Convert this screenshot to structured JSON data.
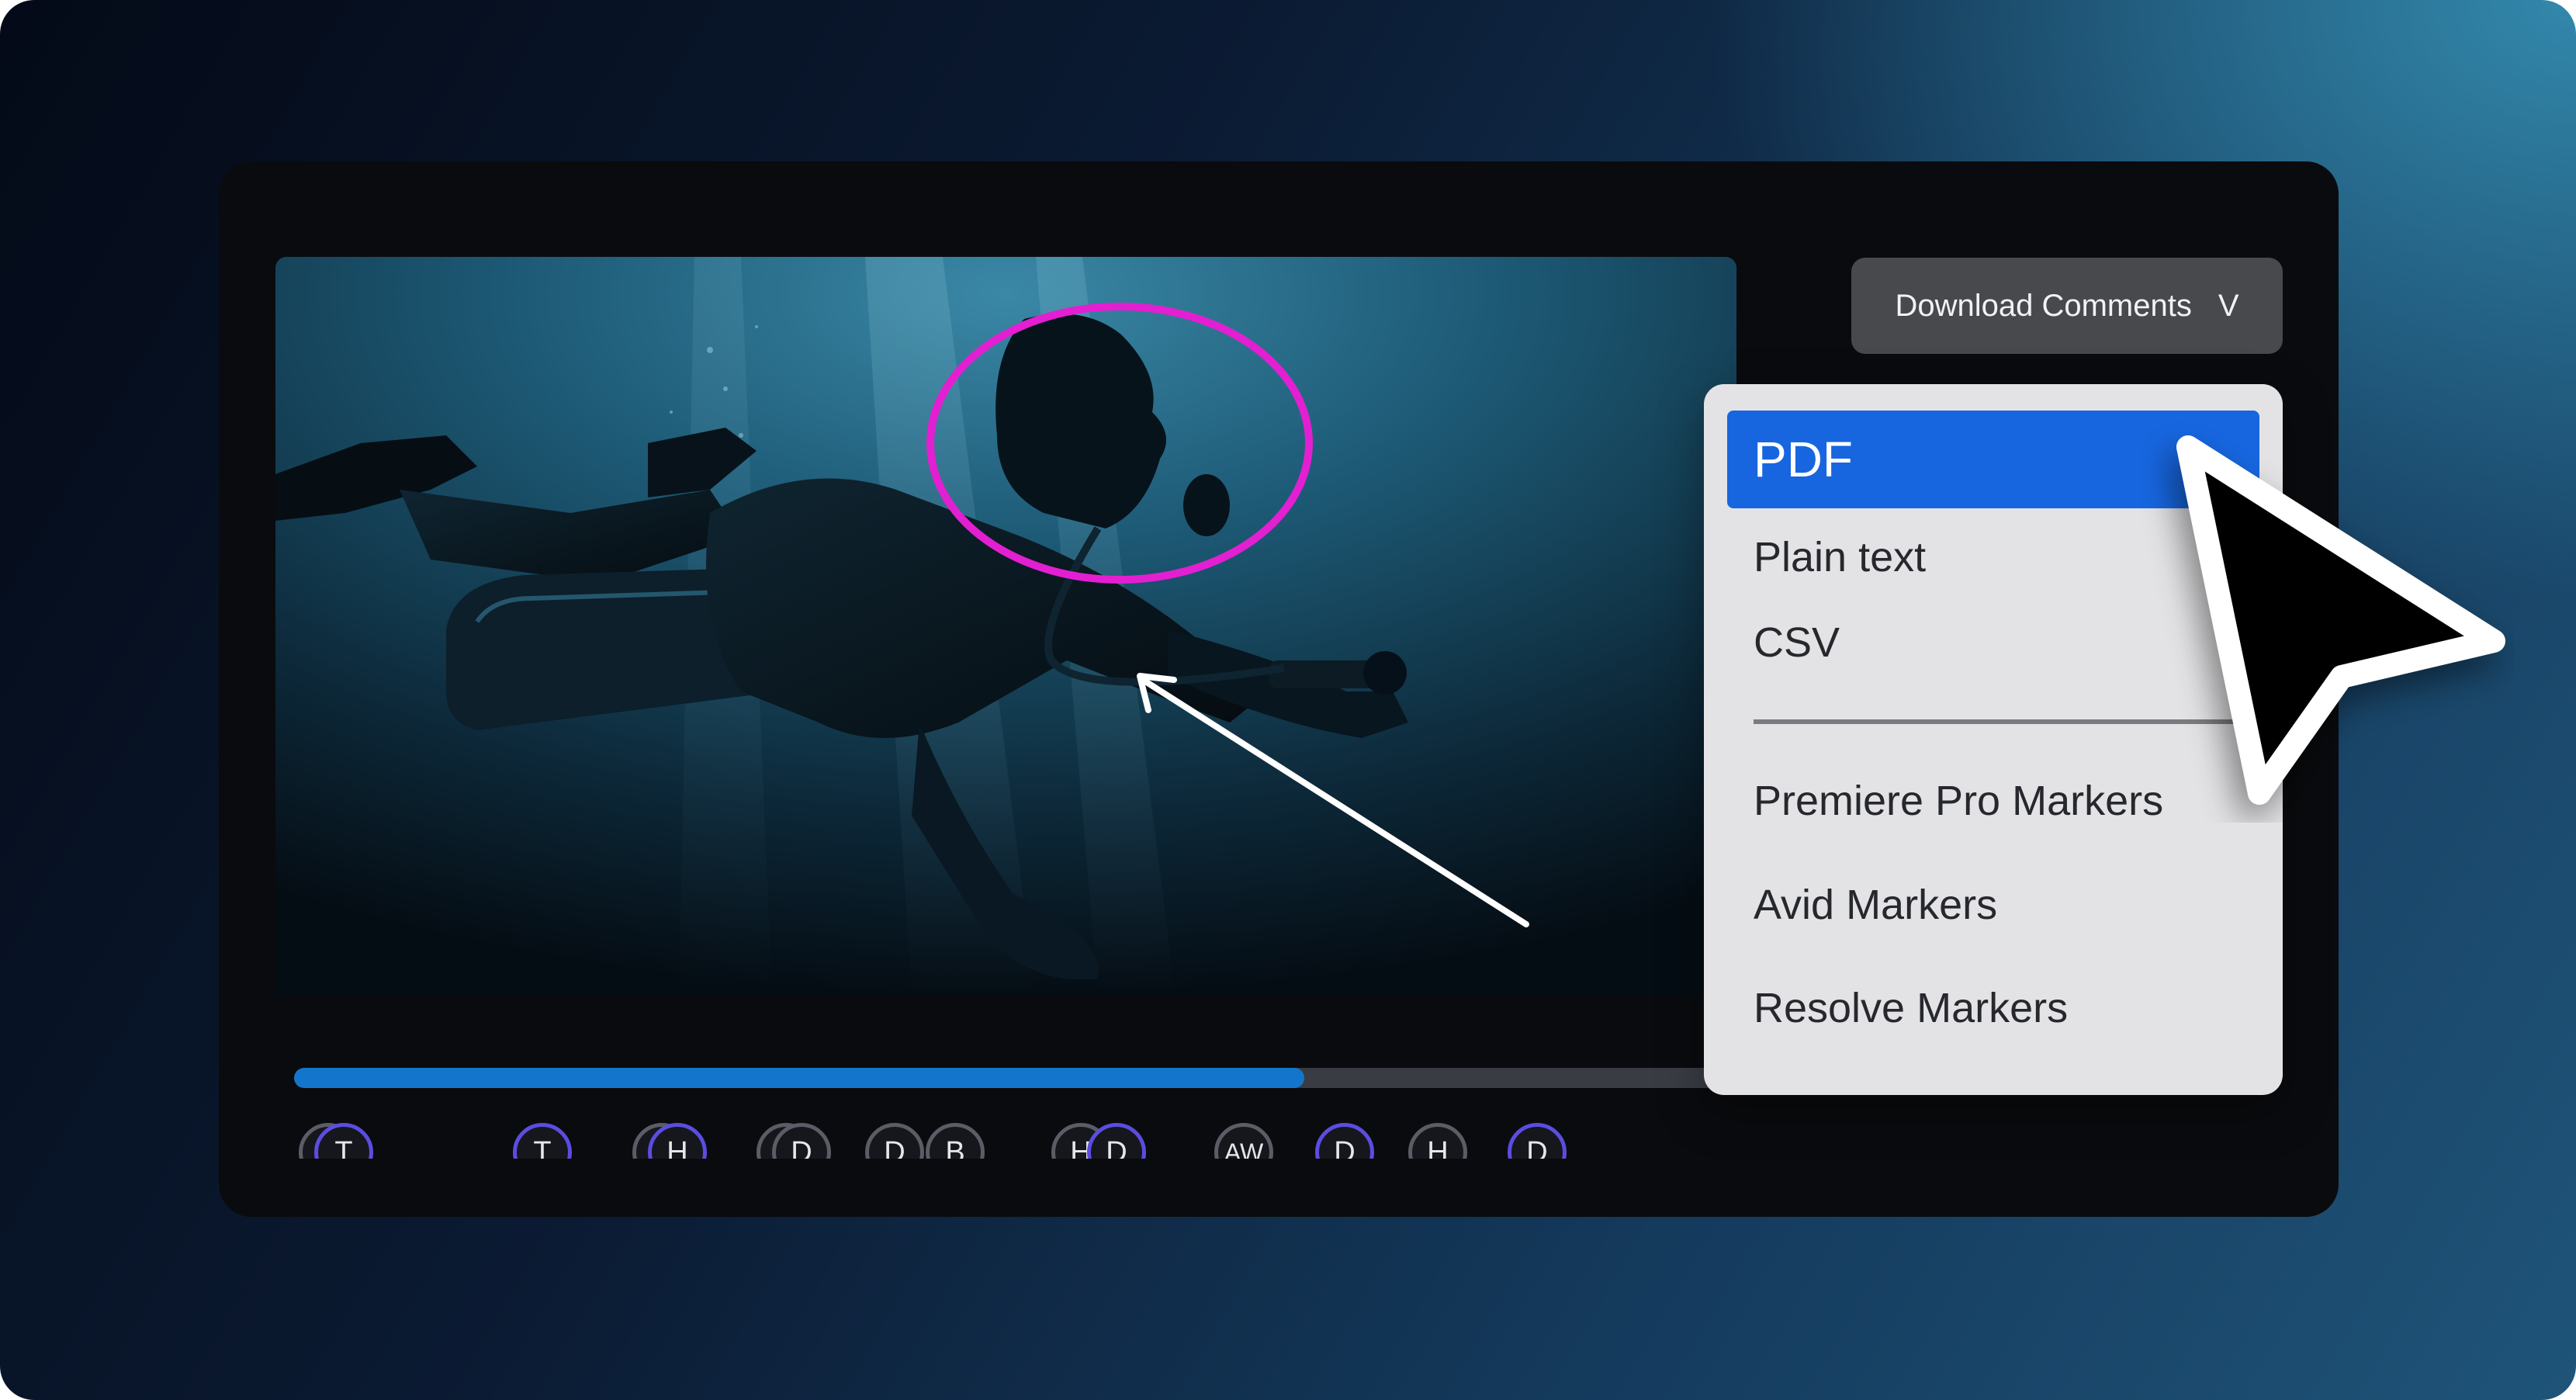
{
  "colors": {
    "accent_blue": "#1766e0",
    "progress_fill": "#1376cc",
    "annotation_magenta": "#e31fd2",
    "marker_active_border": "#5b4de0",
    "marker_inactive_border": "#5a5d66"
  },
  "player": {
    "progress": 0.7
  },
  "timeline_markers": [
    {
      "label": "T",
      "active": false
    },
    {
      "label": "T",
      "active": true
    },
    {
      "label": "T",
      "active": true
    },
    {
      "label": "H",
      "active": false
    },
    {
      "label": "H",
      "active": true
    },
    {
      "label": "D",
      "active": false
    },
    {
      "label": "D",
      "active": false
    },
    {
      "label": "D",
      "active": false
    },
    {
      "label": "B",
      "active": false
    },
    {
      "label": "H",
      "active": false
    },
    {
      "label": "D",
      "active": true
    },
    {
      "label": "AW",
      "active": false
    },
    {
      "label": "D",
      "active": true
    },
    {
      "label": "H",
      "active": false
    },
    {
      "label": "D",
      "active": true
    }
  ],
  "download": {
    "label": "Download Comments",
    "chevron": "V"
  },
  "menu": {
    "items": [
      {
        "label": "PDF",
        "selected": true
      },
      {
        "label": "Plain text"
      },
      {
        "label": "CSV"
      },
      {
        "label": "Premiere Pro Markers"
      },
      {
        "label": "Avid Markers"
      },
      {
        "label": "Resolve Markers"
      }
    ]
  },
  "icons": {
    "cursor": "mouse-pointer-arrow-icon",
    "annotation_circle": "ellipse-annotation",
    "annotation_arrow": "arrow-annotation"
  }
}
